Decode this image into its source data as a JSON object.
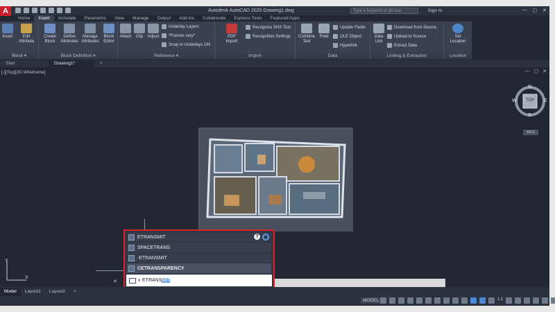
{
  "app": {
    "title": "Autodesk AutoCAD 2020  Drawing1.dwg",
    "logo_letter": "A",
    "search_placeholder": "Type a keyword or phrase",
    "sign_in": "Sign In"
  },
  "ribbon_tabs": [
    "Home",
    "Insert",
    "Annotate",
    "Parametric",
    "View",
    "Manage",
    "Output",
    "Add-ins",
    "Collaborate",
    "Express Tools",
    "Featured Apps"
  ],
  "ribbon": {
    "block": {
      "insert": "Insert",
      "edit_attribute": "Edit Attribute",
      "title": "Block ▾"
    },
    "block_definition": {
      "create": "Create Block",
      "define": "Define Attributes",
      "manage": "Manage Attributes",
      "editor": "Block Editor",
      "title": "Block Definition ▾"
    },
    "reference": {
      "attach": "Attach",
      "clip": "Clip",
      "adjust": "Adjust",
      "underlay_layers": "Underlay Layers",
      "frames": "*Frames vary*",
      "snap": "Snap to Underlays ON",
      "title": "Reference ▾"
    },
    "import": {
      "pdf_import": "PDF Import",
      "recognize": "Recognize SHX Text",
      "recognition_settings": "Recognition Settings",
      "title": "Import"
    },
    "data": {
      "combine": "Combine Text",
      "field": "Field",
      "update_fields": "Update Fields",
      "ole": "OLE Object",
      "hyperlink": "Hyperlink",
      "title": "Data"
    },
    "linking": {
      "data_link": "Data Link",
      "download": "Download from Source",
      "upload": "Upload to Source",
      "extract": "Extract Data",
      "title": "Linking & Extraction"
    },
    "location": {
      "set": "Set Location",
      "title": "Location"
    }
  },
  "doc_tabs": [
    "Start",
    "Drawing1*",
    "+"
  ],
  "viewport": {
    "label": "[-][Top][2D Wireframe]",
    "viewcube": {
      "top": "TOP",
      "n": "N",
      "s": "S",
      "e": "E",
      "w": "W",
      "wcs": "WCS"
    }
  },
  "command_suggestions": [
    "ETRANSMIT",
    "SPACETRANS",
    "-ETRANSMIT",
    "CETRANSPARENCY"
  ],
  "command_input": {
    "typed": "ETRANS",
    "completion": "MIT"
  },
  "layout_tabs": [
    "Model",
    "Layout1",
    "Layout2",
    "+"
  ],
  "status": {
    "model": "MODEL",
    "scale": "1:1"
  },
  "colors": {
    "accent": "#e0202a",
    "ribbon_bg": "#3a4150",
    "canvas": "#222733"
  }
}
